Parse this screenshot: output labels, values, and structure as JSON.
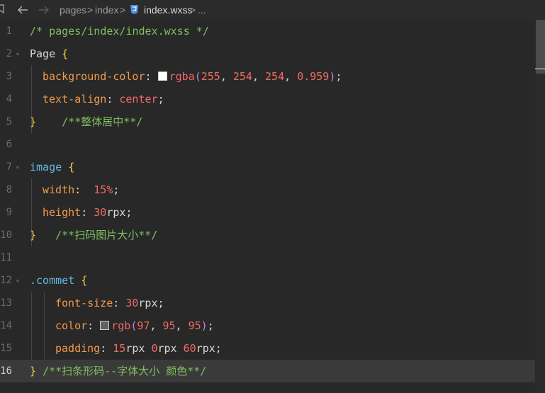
{
  "breadcrumb": {
    "items": [
      "pages",
      "index",
      "index.wxss",
      "..."
    ],
    "separator": ">"
  },
  "icons": {
    "file_icon": "css-file-icon",
    "back": "arrow-left-icon",
    "forward": "arrow-right-icon"
  },
  "colors": {
    "background": "#282828",
    "comment": "#7fbf5f",
    "selector": "#62b8e0",
    "brace": "#f5d64b",
    "property": "#f29b4b",
    "value": "#f06a66",
    "css_file_icon": "#4a8fe0"
  },
  "editor": {
    "active_line": 16,
    "lines": [
      {
        "num": "1",
        "comment": "/* pages/index/index.wxss */"
      },
      {
        "num": "2",
        "selector": "Page",
        "brace": "{"
      },
      {
        "num": "3",
        "property": "background-color",
        "colon": ":",
        "fn": "rgba",
        "open": "(",
        "args": [
          "255",
          "254",
          "254",
          "0.959"
        ],
        "close": ")",
        "semi": ";"
      },
      {
        "num": "4",
        "property": "text-align",
        "colon": ":",
        "value": "center",
        "semi": ";"
      },
      {
        "num": "5",
        "brace": "}",
        "comment": "/**整体居中**/"
      },
      {
        "num": "6"
      },
      {
        "num": "7",
        "selector": "image",
        "brace": "{"
      },
      {
        "num": "8",
        "property": "width",
        "colon": ":",
        "number": "15%",
        "semi": ";"
      },
      {
        "num": "9",
        "property": "height",
        "colon": ":",
        "number": "30",
        "unit": "rpx",
        "semi": ";"
      },
      {
        "num": "10",
        "brace": "}",
        "comment": "/**扫码图片大小**/"
      },
      {
        "num": "11"
      },
      {
        "num": "12",
        "selector": ".commet",
        "brace": "{"
      },
      {
        "num": "13",
        "property": "font-size",
        "colon": ":",
        "number": "30",
        "unit": "rpx",
        "semi": ";"
      },
      {
        "num": "14",
        "property": "color",
        "colon": ":",
        "fn": "rgb",
        "open": "(",
        "args": [
          "97",
          "95",
          "95"
        ],
        "close": ")",
        "semi": ";"
      },
      {
        "num": "15",
        "property": "padding",
        "colon": ":",
        "p1": "15",
        "u1": "rpx",
        "p2": "0",
        "u2": "rpx",
        "p3": "60",
        "u3": "rpx",
        "semi": ";"
      },
      {
        "num": "16",
        "brace": "}",
        "comment": "/**扫条形码--字体大小 颜色**/"
      }
    ]
  },
  "swatches": {
    "line3": "#fffefe",
    "line14": "#615f5f"
  }
}
